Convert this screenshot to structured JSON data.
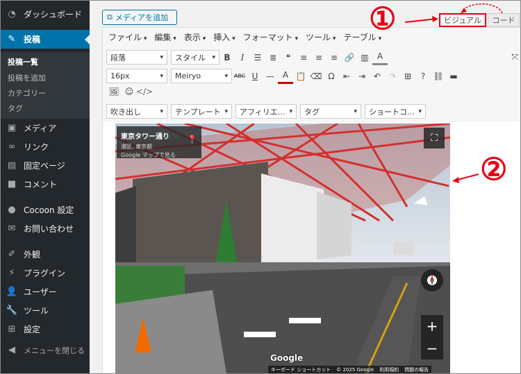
{
  "sidebar": {
    "dashboard": "ダッシュボード",
    "posts": "投稿",
    "sub": [
      "投稿一覧",
      "投稿を追加",
      "カテゴリー",
      "タグ"
    ],
    "items": [
      "メディア",
      "リンク",
      "固定ページ",
      "コメント",
      "Cocoon 設定",
      "お問い合わせ",
      "外観",
      "プラグイン",
      "ユーザー",
      "ツール",
      "設定",
      "メニューを閉じる"
    ]
  },
  "toolbar": {
    "add_media": "メディアを追加"
  },
  "tabs": {
    "visual": "ビジュアル",
    "code": "コード"
  },
  "menubar": [
    "ファイル",
    "編集",
    "表示",
    "挿入",
    "フォーマット",
    "ツール",
    "テーブル"
  ],
  "selects": {
    "paragraph": "段落",
    "style": "スタイル",
    "font_size": "16px",
    "font_family": "Meiryo",
    "balloon": "吹き出し",
    "template": "テンプレート",
    "affiliate": "アフィリエ...",
    "tag": "タグ",
    "shortcode": "ショートコ..."
  },
  "streetview": {
    "title": "東京タワー通り",
    "subtitle": "港区, 東京都",
    "link": "Google マップで見る",
    "google": "Google",
    "footer": [
      "キーボード ショートカット",
      "© 2025 Google",
      "利用規約",
      "問題の報告"
    ]
  },
  "annotations": {
    "one": "①",
    "two": "②"
  },
  "colors": {
    "accent": "#0073aa",
    "sidebar": "#23282d",
    "highlight": "#e60012"
  },
  "icons": [
    "dashboard-icon",
    "pin-icon",
    "media-icon",
    "link-icon",
    "page-icon",
    "comment-icon",
    "cocoon-icon",
    "mail-icon",
    "appearance-icon",
    "plugin-icon",
    "user-icon",
    "tool-icon",
    "settings-icon",
    "collapse-icon"
  ]
}
